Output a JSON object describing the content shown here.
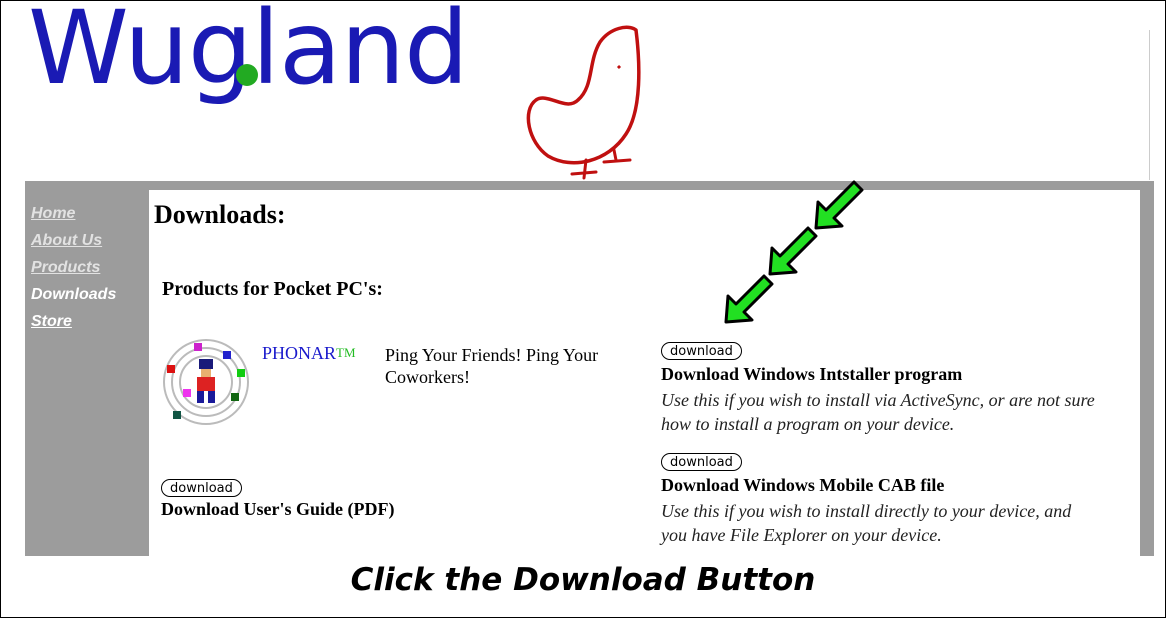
{
  "logo": {
    "text": "Wugland"
  },
  "nav": {
    "items": [
      {
        "label": "Home"
      },
      {
        "label": "About Us"
      },
      {
        "label": "Products"
      },
      {
        "label": "Downloads",
        "current": true
      },
      {
        "label": "Store"
      }
    ]
  },
  "main": {
    "title": "Downloads:",
    "section_title": "Products for Pocket PC's:",
    "product": {
      "name": "PHONAR",
      "trademark": "TM",
      "tagline": "Ping Your Friends! Ping Your Coworkers!"
    },
    "user_guide": {
      "button_label": "download",
      "title": "Download User's Guide (PDF)"
    },
    "installer": {
      "button_label": "download",
      "title": "Download Windows Intstaller program",
      "description": "Use this if you wish to install via ActiveSync, or are not sure how to install a program on your device."
    },
    "cab": {
      "button_label": "download",
      "title": "Download Windows Mobile CAB file",
      "description": "Use this if you wish to install directly to your device, and you have File Explorer on your device."
    }
  },
  "caption": "Click the Download Button",
  "colors": {
    "logo_blue": "#1a1ab4",
    "logo_green_dot": "#22aa22",
    "bird_red": "#c01010",
    "sidebar_grey": "#9c9c9c",
    "arrow_green": "#22e022"
  }
}
